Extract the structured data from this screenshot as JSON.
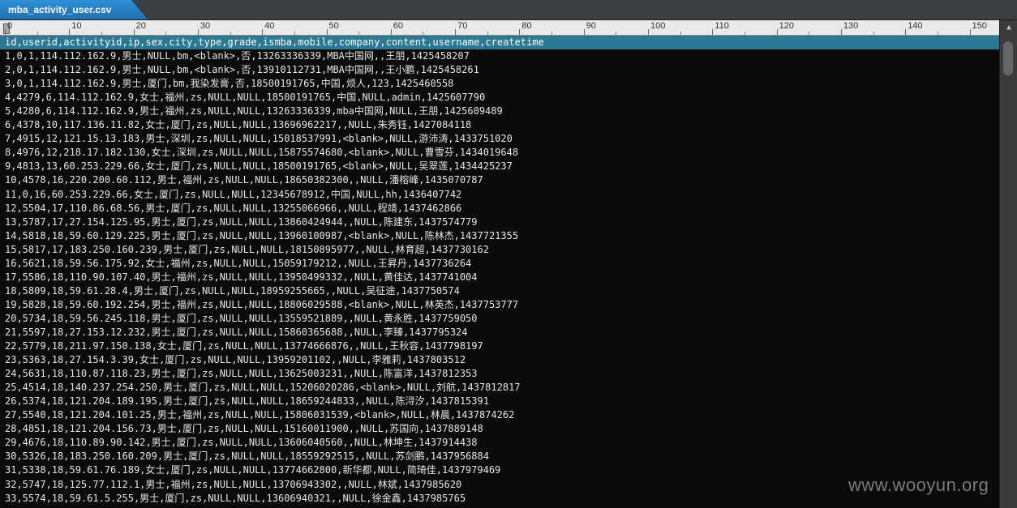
{
  "tab": {
    "title": "mba_activity_user.csv"
  },
  "ruler": {
    "labels": [
      "0",
      "10",
      "20",
      "30",
      "40",
      "50",
      "60",
      "70",
      "80",
      "90",
      "100",
      "110",
      "120",
      "130",
      "140",
      "150"
    ]
  },
  "editor": {
    "header": "id,userid,activityid,ip,sex,city,type,grade,ismba,mobile,company,content,username,createtime",
    "lines": [
      "1,0,1,114.112.162.9,男士,NULL,bm,<blank>,否,13263336339,MBA中国网,,王朋,1425458207",
      "2,0,1,114.112.162.9,男士,NULL,bm,<blank>,否,13910112731,MBA中国网,,王小鹏,1425458261",
      "3,0,1,114.112.162.9,男士,厦门,bm,我染发膏,否,18500191765,中国,烦人,123,1425460558",
      "4,4279,6,114.112.162.9,女士,福州,zs,NULL,NULL,18500191765,中国,NULL,admin,1425607790",
      "5,4280,6,114.112.162.9,男士,福州,zs,NULL,NULL,13263336339,mba中国网,NULL,王朋,1425609489",
      "6,4378,10,117.136.11.82,女士,厦门,zs,NULL,NULL,13696962217,,NULL,朱秀钰,1427084118",
      "7,4915,12,121.15.13.183,男士,深圳,zs,NULL,NULL,15018537991,<blank>,NULL,游沛涛,1433751020",
      "8,4976,12,218.17.182.130,女士,深圳,zs,NULL,NULL,15875574680,<blank>,NULL,曹雪芬,1434019648",
      "9,4813,13,60.253.229.66,女士,厦门,zs,NULL,NULL,18500191765,<blank>,NULL,吴翠莲,1434425237",
      "10,4578,16,220.200.60.112,男士,福州,zs,NULL,NULL,18650382300,,NULL,潘榕峰,1435070787",
      "11,0,16,60.253.229.66,女士,厦门,zs,NULL,NULL,12345678912,中国,NULL,hh,1436407742",
      "12,5504,17,110.86.68.56,男士,厦门,zs,NULL,NULL,13255066966,,NULL,程靖,1437462866",
      "13,5787,17,27.154.125.95,男士,厦门,zs,NULL,NULL,13860424944,,NULL,陈建东,1437574779",
      "14,5818,18,59.60.129.225,男士,厦门,zs,NULL,NULL,13960100987,<blank>,NULL,陈林杰,1437721355",
      "15,5817,17,183.250.160.239,男士,厦门,zs,NULL,NULL,18150895977,,NULL,林育超,1437730162",
      "16,5621,18,59.56.175.92,女士,福州,zs,NULL,NULL,15059179212,,NULL,王昇丹,1437736264",
      "17,5586,18,110.90.107.40,男士,福州,zs,NULL,NULL,13950499332,,NULL,黄佳达,1437741004",
      "18,5809,18,59.61.28.4,男士,厦门,zs,NULL,NULL,18959255665,,NULL,吴征途,1437750574",
      "19,5828,18,59.60.192.254,男士,福州,zs,NULL,NULL,18806029588,<blank>,NULL,林英杰,1437753777",
      "20,5734,18,59.56.245.118,男士,厦门,zs,NULL,NULL,13559521889,,NULL,黄永胜,1437759050",
      "21,5597,18,27.153.12.232,男士,厦门,zs,NULL,NULL,15860365688,,NULL,李臻,1437795324",
      "22,5779,18,211.97.150.138,女士,厦门,zs,NULL,NULL,13774666876,,NULL,王秋容,1437798197",
      "23,5363,18,27.154.3.39,女士,厦门,zs,NULL,NULL,13959201102,,NULL,李雅莉,1437803512",
      "24,5631,18,110.87.118.23,男士,厦门,zs,NULL,NULL,13625003231,,NULL,陈富洋,1437812353",
      "25,4514,18,140.237.254.250,男士,厦门,zs,NULL,NULL,15206020286,<blank>,NULL,刘航,1437812817",
      "26,5374,18,121.204.189.195,男士,厦门,zs,NULL,NULL,18659244833,,NULL,陈浔汐,1437815391",
      "27,5540,18,121.204.101.25,男士,福州,zs,NULL,NULL,15806031539,<blank>,NULL,林晨,1437874262",
      "28,4851,18,121.204.156.73,男士,厦门,zs,NULL,NULL,15160011900,,NULL,苏国向,1437889148",
      "29,4676,18,110.89.90.142,男士,厦门,zs,NULL,NULL,13606040560,,NULL,林坤生,1437914438",
      "30,5326,18,183.250.160.209,男士,厦门,zs,NULL,NULL,18559292515,,NULL,苏剑鹏,1437956884",
      "31,5338,18,59.61.76.189,女士,厦门,zs,NULL,NULL,13774662800,新华都,NULL,简琦佳,1437979469",
      "32,5747,18,125.77.112.1,男士,福州,zs,NULL,NULL,13706943302,,NULL,林斌,1437985620",
      "33,5574,18,59.61.5.255,男士,厦门,zs,NULL,NULL,13606940321,,NULL,徐金鑫,1437985765"
    ]
  },
  "icons": {
    "scroll_up": "chevron-up-icon",
    "scroll_down": "chevron-down-icon"
  },
  "watermark": "www.wooyun.org"
}
